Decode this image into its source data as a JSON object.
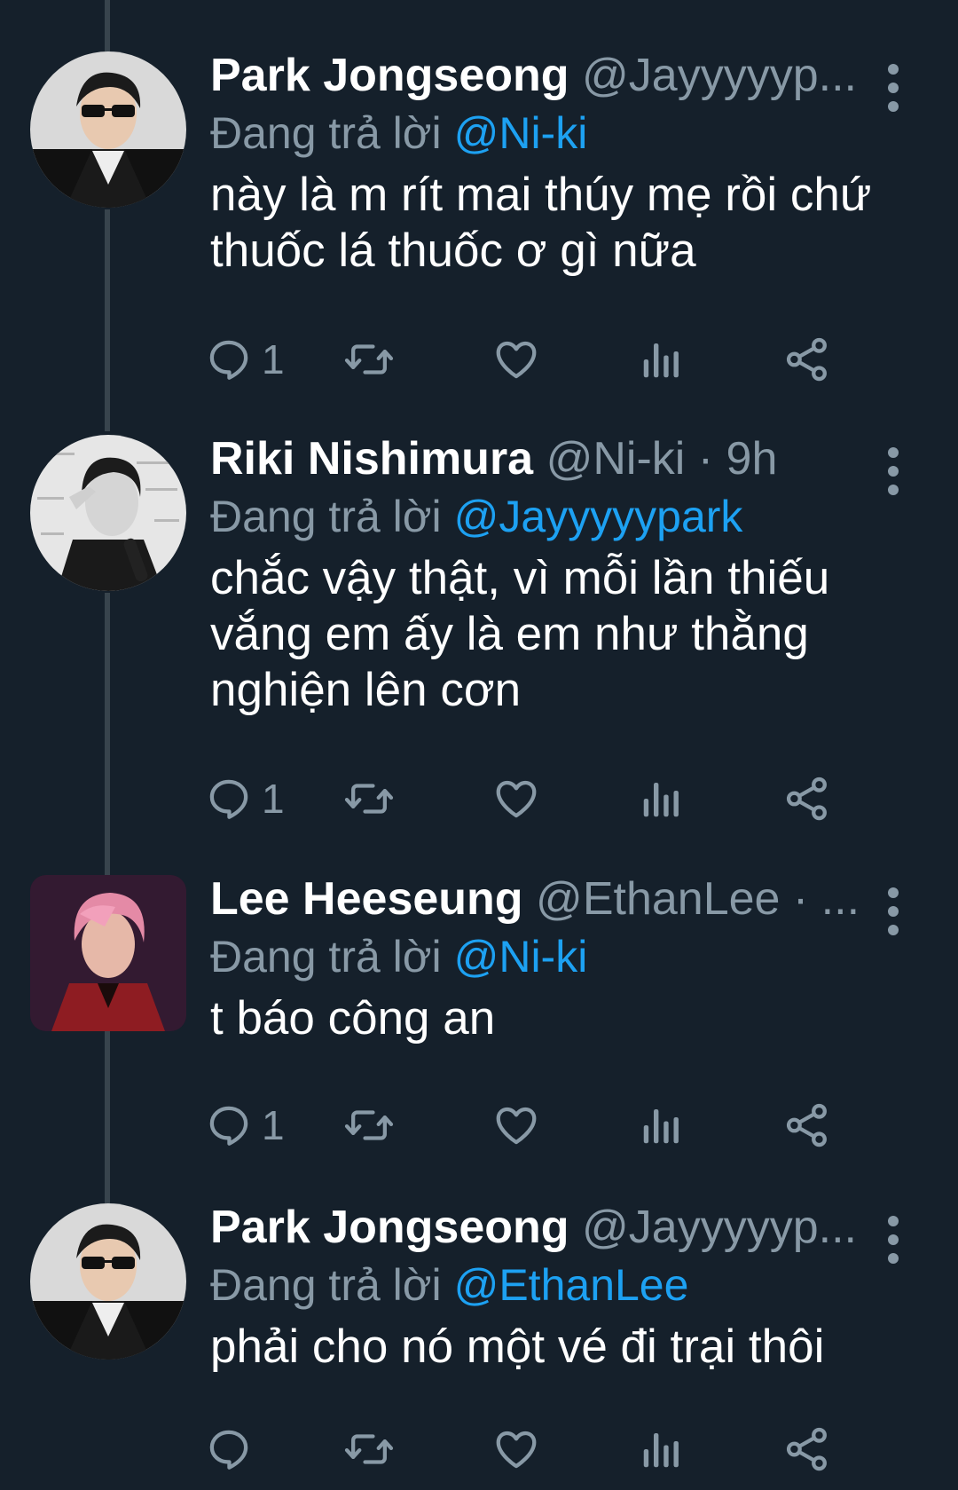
{
  "colors": {
    "background": "#15202b",
    "muted": "#8899a6",
    "link": "#1da1f2",
    "thread_line": "#38444d"
  },
  "tweets": [
    {
      "name": "Park Jongseong",
      "handle": "@Jayyyyyp...",
      "replying_prefix": "Đang trả lời",
      "replying_to": "@Ni-ki",
      "text_lines": [
        "này là m rít mai thúy mẹ rồi chứ",
        "thuốc lá thuốc ơ gì nữa"
      ],
      "reply_count": "1"
    },
    {
      "name": "Riki Nishimura",
      "handle": "@Ni-ki · 9h",
      "replying_prefix": "Đang trả lời",
      "replying_to": "@Jayyyyypark",
      "text_lines": [
        "chắc vậy thật, vì mỗi lần thiếu",
        "vắng em ấy là em như thằng",
        "nghiện lên cơn"
      ],
      "reply_count": "1"
    },
    {
      "name": "Lee Heeseung",
      "handle": "@EthanLee · ...",
      "replying_prefix": "Đang trả lời",
      "replying_to": "@Ni-ki",
      "text_lines": [
        "t báo công an"
      ],
      "reply_count": "1"
    },
    {
      "name": "Park Jongseong",
      "handle": "@Jayyyyyp...",
      "replying_prefix": "Đang trả lời",
      "replying_to": "@EthanLee",
      "text_lines": [
        "phải cho nó một vé đi trại thôi"
      ],
      "reply_count": ""
    }
  ],
  "icons": [
    "reply-icon",
    "retweet-icon",
    "like-icon",
    "analytics-icon",
    "share-icon",
    "more-options-icon"
  ]
}
